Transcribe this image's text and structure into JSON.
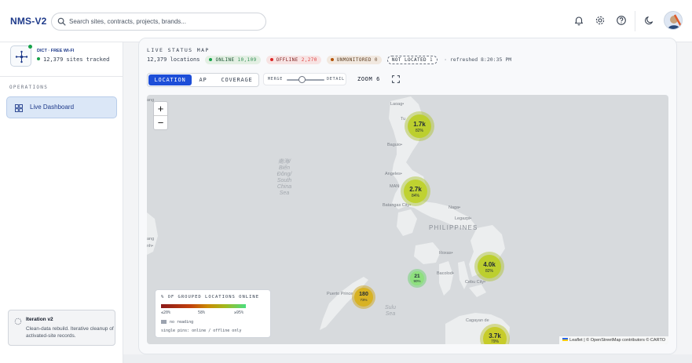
{
  "app": {
    "logo": "NMS-V2"
  },
  "search": {
    "placeholder": "Search sites, contracts, projects, brands..."
  },
  "topbar_icons": [
    "bell-icon",
    "gear-icon",
    "help-icon",
    "moon-icon"
  ],
  "org": {
    "title": "DICT · FREE WI-FI",
    "sites_tracked": "12,379 sites tracked"
  },
  "sidebar": {
    "section_label": "OPERATIONS",
    "items": [
      {
        "label": "Live Dashboard",
        "icon": "dashboard-icon",
        "active": true
      }
    ],
    "iteration": {
      "title": "Iteration v2",
      "desc": "Clean-data rebuild. Iterative cleanup of activated-site records."
    }
  },
  "status": {
    "title": "LIVE STATUS MAP",
    "locations": "12,379 locations",
    "online_label": "ONLINE",
    "online_count": "10,109",
    "offline_label": "OFFLINE",
    "offline_count": "2,270",
    "unmon_label": "UNMONITORED",
    "unmon_count": "0",
    "notloc_label": "NOT LOCATED",
    "notloc_count": "1",
    "refreshed": "· refreshed 8:20:35 PM"
  },
  "controls": {
    "tabs": [
      "LOCATION",
      "AP",
      "COVERAGE"
    ],
    "active_tab": "LOCATION",
    "merge_label": "MERGE",
    "detail_label": "DETAIL",
    "merge_level": 0.4,
    "zoom": "ZOOM 6"
  },
  "map": {
    "zoom_in": "+",
    "zoom_out": "−",
    "places": {
      "laoag": "Laoag•",
      "tuguegarao": "Tu",
      "baguio": "Baguio•",
      "angeles": "Angeles•",
      "manila": "MAN",
      "batangas": "Batangas City•",
      "naga": "Naga•",
      "legazpi": "Legazpi•",
      "philippines": "PHILIPPINES",
      "roxas": "Roxas•",
      "bacolod": "Bacolod•",
      "cebu": "Cebu City•",
      "puerto": "Puerto Prince",
      "cagayan": "Cagayan de",
      "ang": "ang",
      "nh": "nh•"
    },
    "sea_south_china": "南海/\nBiển\nĐông/\nSouth\nChina\nSea",
    "sea_sulu": "Sulu\nSea",
    "clusters": [
      {
        "value": "1.7k",
        "pct": "82%",
        "online_share": 0.82
      },
      {
        "value": "2.7k",
        "pct": "84%",
        "online_share": 0.84
      },
      {
        "value": "21",
        "pct": "90%",
        "online_share": 0.9
      },
      {
        "value": "4.0k",
        "pct": "82%",
        "online_share": 0.82
      },
      {
        "value": "180",
        "pct": "73%",
        "online_share": 0.73
      },
      {
        "value": "3.7k",
        "pct": "79%",
        "online_share": 0.79
      }
    ],
    "legend": {
      "title": "% OF GROUPED LOCATIONS ONLINE",
      "ticks": [
        "≤20%",
        "58%",
        "≥95%"
      ],
      "no_reading": "no reading",
      "single_pins": "single pins: online / offline only"
    },
    "attribution": "Leaflet | © OpenStreetMap contributors © CARTO"
  },
  "colors": {
    "accent": "#1d4ed8",
    "online": "#16a34a",
    "offline": "#dc2626",
    "unmonitored": "#b45309"
  }
}
